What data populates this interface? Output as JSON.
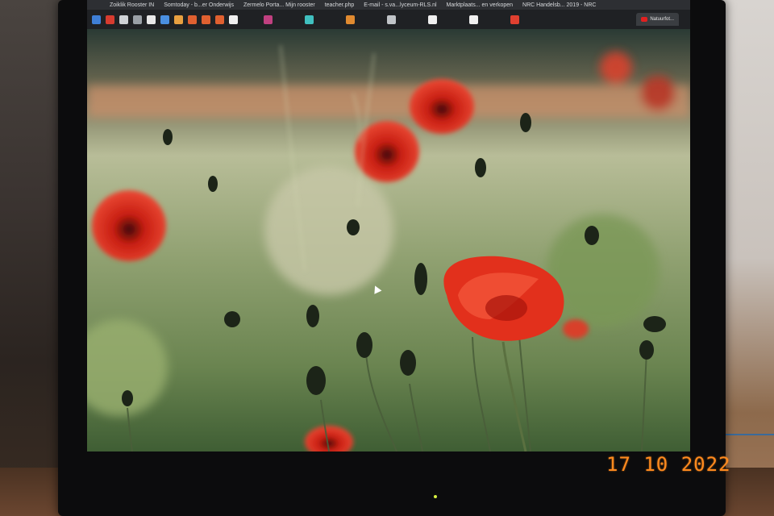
{
  "browser": {
    "bookmarks": [
      "Zoiklik Rooster IN",
      "Somtoday - b...er Onderwijs",
      "Zermelo Porta... Mijn rooster",
      "teacher.php",
      "E-mail - s.va...lyceum-RLS.nl",
      "Marktplaats... en verkopen",
      "NRC Handelsb... 2019 - NRC"
    ],
    "active_tab_label": "Natuurfot..."
  },
  "photo_stamp": {
    "date": "17 10 2022",
    "color": "#ff8a1e"
  },
  "wallpaper": {
    "subject": "red poppy field",
    "accent_color": "#e2301c",
    "foliage_color": "#6f8a52"
  }
}
